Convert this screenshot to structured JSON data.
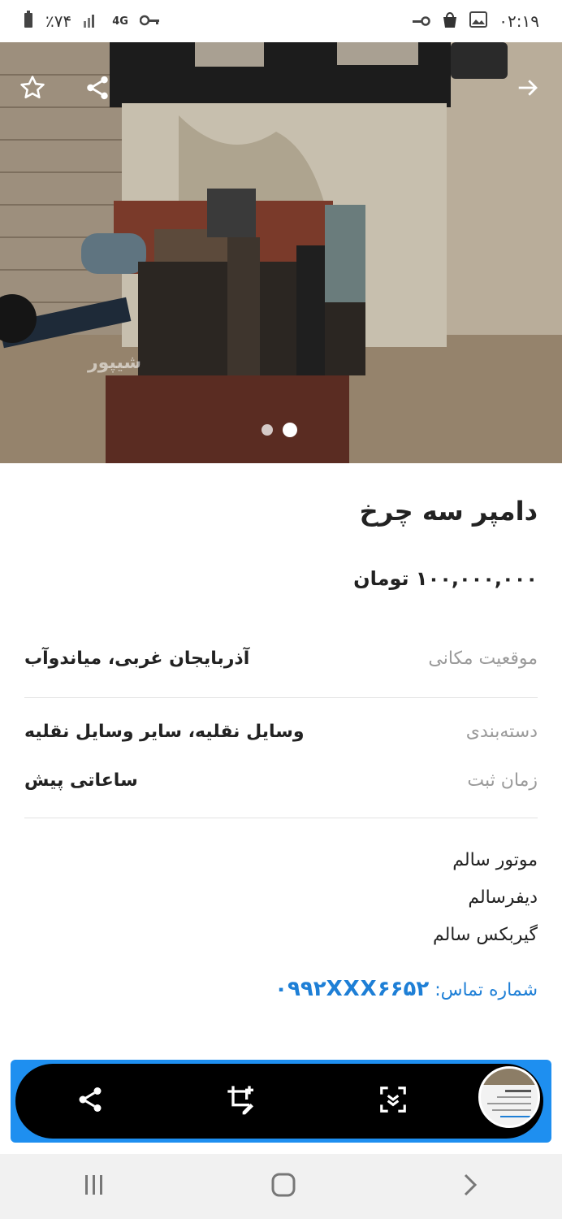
{
  "status_bar": {
    "time": "۰۲:۱۹",
    "battery": "٪۷۴",
    "network": "4G"
  },
  "listing": {
    "title": "دامپر سه چرخ",
    "price": "۱۰۰,۰۰۰,۰۰۰ تومان",
    "location_label": "موقعیت مکانی",
    "location_value": "آذربایجان غربی، میاندوآب",
    "category_label": "دسته‌بندی",
    "category_value": "وسایل نقلیه، سایر وسایل نقلیه",
    "time_label": "زمان ثبت",
    "time_value": "ساعاتی پیش",
    "description": [
      "موتور سالم",
      "دیفرسالم",
      "گیربکس سالم"
    ],
    "contact_label": "شماره تماس:",
    "contact_number": "۰۹۹۲XXX۶۶۵۲"
  },
  "gallery": {
    "watermark": "شیپور",
    "slides": 2,
    "active_slide": 2
  },
  "icons": [
    "star-icon",
    "share-icon",
    "arrow-right-icon",
    "crop-edit-icon",
    "scroll-capture-icon",
    "recents-icon",
    "home-icon",
    "back-icon"
  ],
  "colors": {
    "accent": "#1e7fd6",
    "toolbar_border": "#1e8ff0"
  }
}
